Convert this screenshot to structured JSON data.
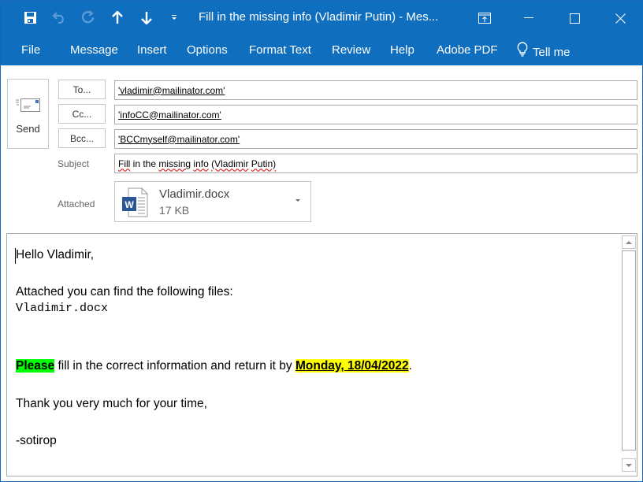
{
  "titlebar": {
    "title": "Fill in the missing info (Vladimir Putin)  -  Mes...",
    "quick_access": [
      {
        "icon": "save-icon"
      },
      {
        "icon": "undo-icon",
        "enabled": false
      },
      {
        "icon": "redo-icon",
        "enabled": false
      },
      {
        "icon": "previous-item-icon"
      },
      {
        "icon": "next-item-icon"
      },
      {
        "icon": "customize-quick-access-icon"
      }
    ],
    "window_controls": [
      "ribbon-display-options-icon",
      "minimize-icon",
      "maximize-icon",
      "close-icon"
    ]
  },
  "ribbon": {
    "tabs": [
      "File",
      "Message",
      "Insert",
      "Options",
      "Format Text",
      "Review",
      "Help",
      "Adobe PDF"
    ],
    "tell_me": "Tell me"
  },
  "compose": {
    "send_label": "Send",
    "to_button": "To...",
    "cc_button": "Cc...",
    "bcc_button": "Bcc...",
    "to_value": "'vladimir@mailinator.com'",
    "cc_value": "'infoCC@mailinator.com'",
    "bcc_value": "'BCCmyself@mailinator.com'",
    "subject_label": "Subject",
    "subject_words": [
      "Fill",
      "in the",
      "missing",
      "info",
      "(Vladimir",
      "Putin)"
    ],
    "attached_label": "Attached",
    "attachment": {
      "name": "Vladimir.docx",
      "size": "17 KB",
      "icon": "word-document-icon"
    }
  },
  "body": {
    "greeting": "Hello Vladimir,",
    "intro": "Attached you can find the following files:",
    "file_list": "Vladimir.docx",
    "please": "Please",
    "instruction": " fill in the correct information and return it by ",
    "deadline": "Monday, 18/04/2022",
    "period": ".",
    "thanks": "Thank you very much for your time,",
    "signature": "-sotirop"
  },
  "colors": {
    "accent": "#106ebe",
    "highlight_green": "#00ff00",
    "highlight_yellow": "#ffff00"
  }
}
